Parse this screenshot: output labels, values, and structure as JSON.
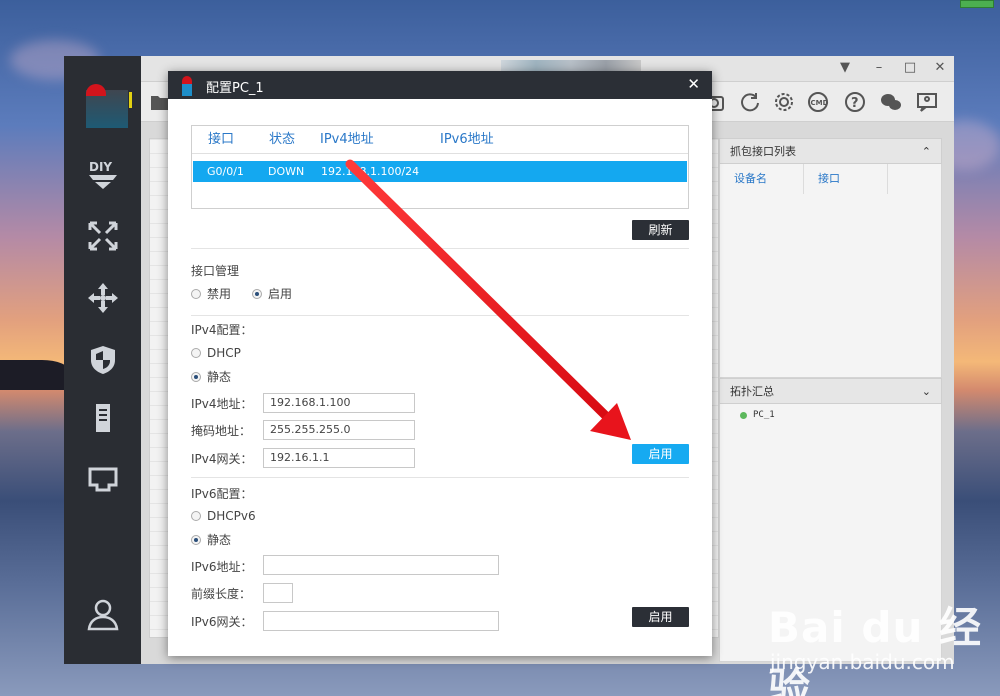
{
  "dialog": {
    "title": "配置PC_1",
    "close": "✕",
    "table": {
      "headers": [
        "接口",
        "状态",
        "IPv4地址",
        "IPv6地址"
      ],
      "rows": [
        {
          "iface": "G0/0/1",
          "status": "DOWN",
          "ipv4": "192.168.1.100/24",
          "ipv6": ""
        }
      ]
    },
    "refresh_label": "刷新",
    "iface_mgmt": {
      "title": "接口管理",
      "disable": "禁用",
      "enable": "启用",
      "selected": "启用"
    },
    "ipv4": {
      "title": "IPv4配置：",
      "dhcp": "DHCP",
      "static": "静态",
      "selected": "静态",
      "addr_label": "IPv4地址：",
      "addr_value": "192.168.1.100",
      "mask_label": "掩码地址：",
      "mask_value": "255.255.255.0",
      "gw_label": "IPv4网关：",
      "gw_value": "192.16.1.1",
      "apply_label": "启用"
    },
    "ipv6": {
      "title": "IPv6配置：",
      "dhcp": "DHCPv6",
      "static": "静态",
      "selected": "静态",
      "addr_label": "IPv6地址：",
      "addr_value": "",
      "prefix_label": "前缀长度：",
      "prefix_value": "",
      "gw_label": "IPv6网关：",
      "gw_value": "",
      "apply_label": "启用"
    }
  },
  "right_panel": {
    "capture_title": "抓包接口列表",
    "capture_toggle": "⌃",
    "capture_cols": [
      "设备名",
      "接口"
    ],
    "topo_title": "拓扑汇总",
    "topo_toggle": "⌄",
    "topo_items": [
      "PC_1"
    ]
  },
  "toolbar": {
    "cmd_label": "CMD"
  },
  "sidebar": {
    "diy_label": "DIY"
  },
  "watermark": {
    "brand": "Bai du 经验",
    "url": "jingyan.baidu.com"
  },
  "colors": {
    "accent_blue": "#16aaf1",
    "dark": "#2b2f36",
    "arrow_red": "#e8141c"
  }
}
